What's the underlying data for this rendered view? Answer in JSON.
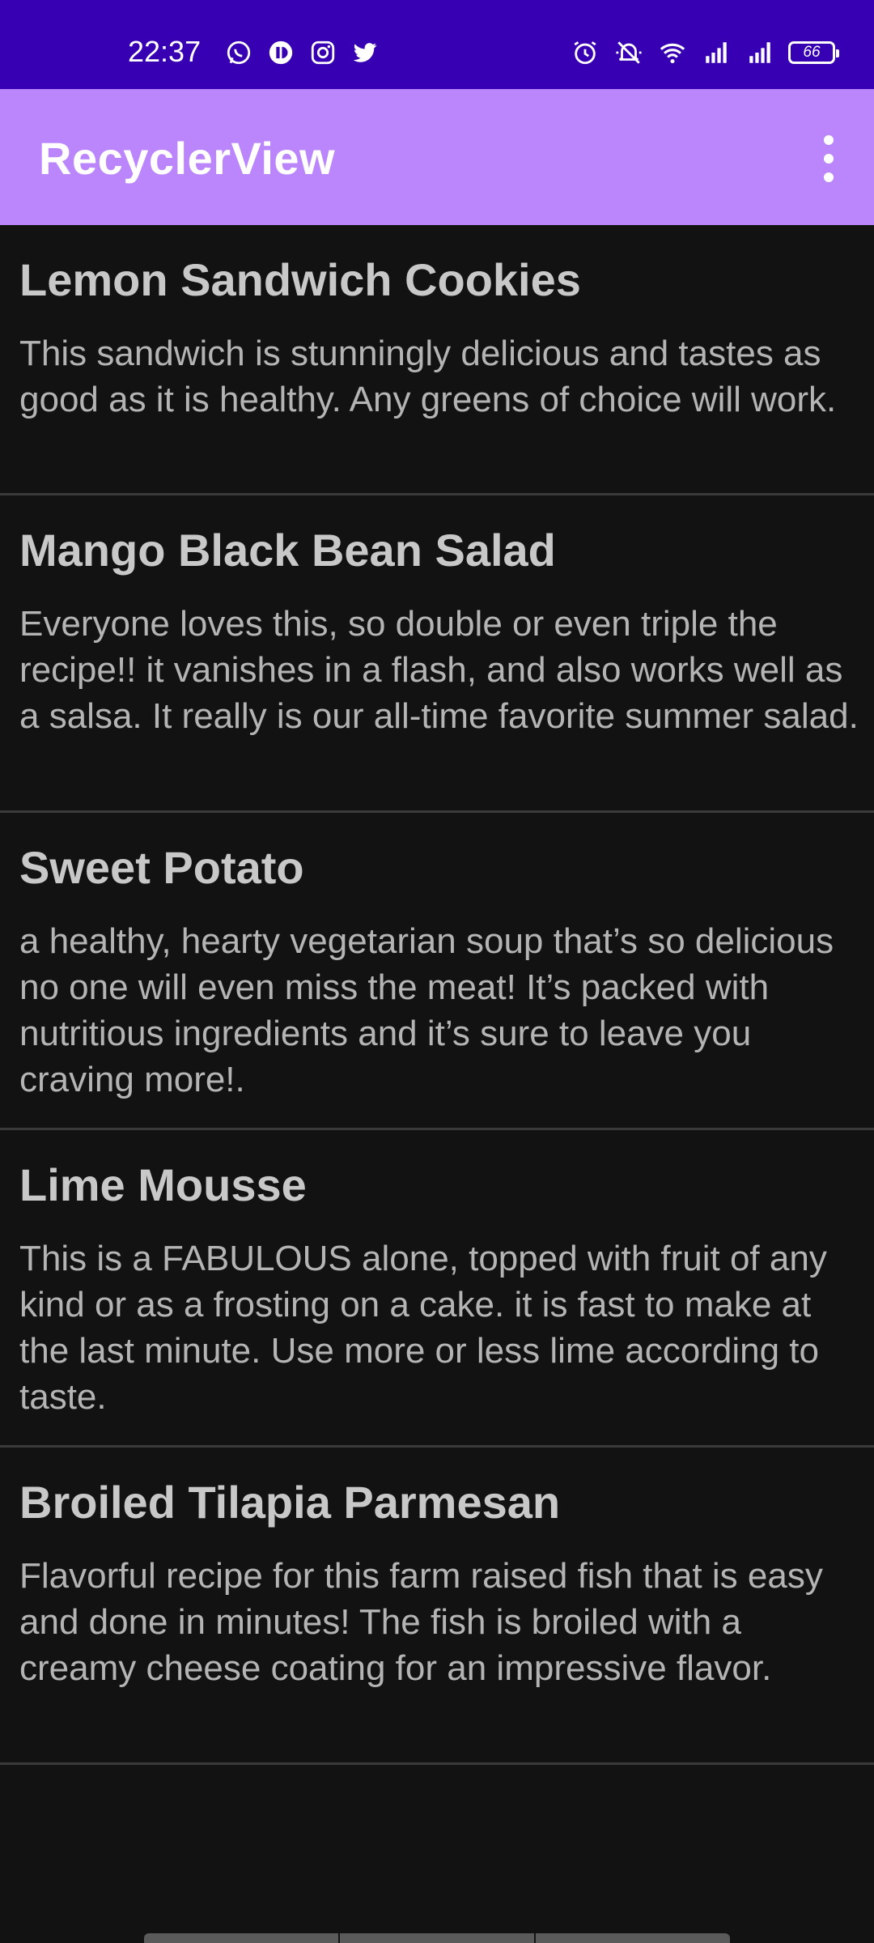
{
  "status_bar": {
    "time": "22:37",
    "left_icons": [
      "whatsapp-icon",
      "messenger-icon",
      "instagram-icon",
      "twitter-icon"
    ],
    "right_icons": [
      "alarm-icon",
      "mute-icon",
      "wifi-icon",
      "signal-icon",
      "signal-icon"
    ],
    "battery": "66"
  },
  "app_bar": {
    "title": "RecyclerView",
    "background": "#bb86fc",
    "overflow_icon": "more-vert-icon"
  },
  "recipes": [
    {
      "title": "Lemon Sandwich Cookies",
      "description": "This sandwich is stunningly delicious and tastes as good as it is healthy. Any greens of choice will work."
    },
    {
      "title": "Mango Black Bean Salad",
      "description": "Everyone loves this, so double or even triple the recipe!! it vanishes in a flash, and also works well as a salsa. It really is our all-time favorite summer salad."
    },
    {
      "title": "Sweet Potato",
      "description": "a healthy, hearty vegetarian soup that’s so delicious no one will even miss the meat! It’s packed with nutritious ingredients and it’s sure to leave you craving more!."
    },
    {
      "title": "Lime Mousse",
      "description": "This is a FABULOUS alone, topped with fruit of any kind or as a frosting on a cake. it is fast to make at the last minute. Use more or less lime according to taste."
    },
    {
      "title": "Broiled Tilapia Parmesan",
      "description": "Flavorful recipe for this farm raised fish that is easy and done in minutes! The fish is broiled with a creamy cheese coating for an impressive flavor."
    }
  ],
  "colors": {
    "status_bar": "#3700b3",
    "background": "#121212",
    "title_text": "#c8c8c8",
    "body_text": "#b4b4b4",
    "divider": "#3a3a3a"
  }
}
